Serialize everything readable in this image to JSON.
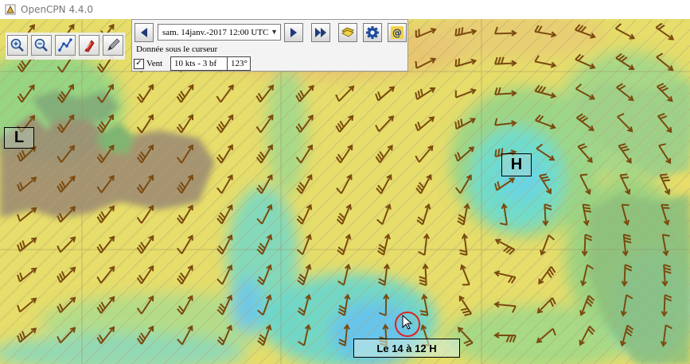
{
  "window": {
    "title": "OpenCPN 4.4.0"
  },
  "toolbar": {
    "buttons": [
      {
        "name": "zoom-in-button",
        "icon": "zoom-in-icon"
      },
      {
        "name": "zoom-out-button",
        "icon": "zoom-out-icon"
      },
      {
        "name": "route-button",
        "icon": "route-icon"
      },
      {
        "name": "ship-button",
        "icon": "ship-icon"
      },
      {
        "name": "pencil-button",
        "icon": "pencil-icon"
      }
    ]
  },
  "grib": {
    "date_value": "sam. 14janv.-2017 12:00  UTC",
    "cursor_data_label": "Donnée sous le curseur",
    "wind_label": "Vent",
    "wind_checked": true,
    "wind_speed": "10 kts - 3 bf",
    "wind_direction": "123°"
  },
  "map": {
    "low_marker": "L",
    "high_marker": "H",
    "footer_label": "Le 14 à 12 H",
    "colors": {
      "yellow": "#e8e06a",
      "green": "#8fd080",
      "cyan": "#6fdcd0",
      "blue": "#66c7ee",
      "land": "#9a8a72",
      "arrow": "#7a4a0e",
      "grid": "#9a8a66"
    }
  }
}
